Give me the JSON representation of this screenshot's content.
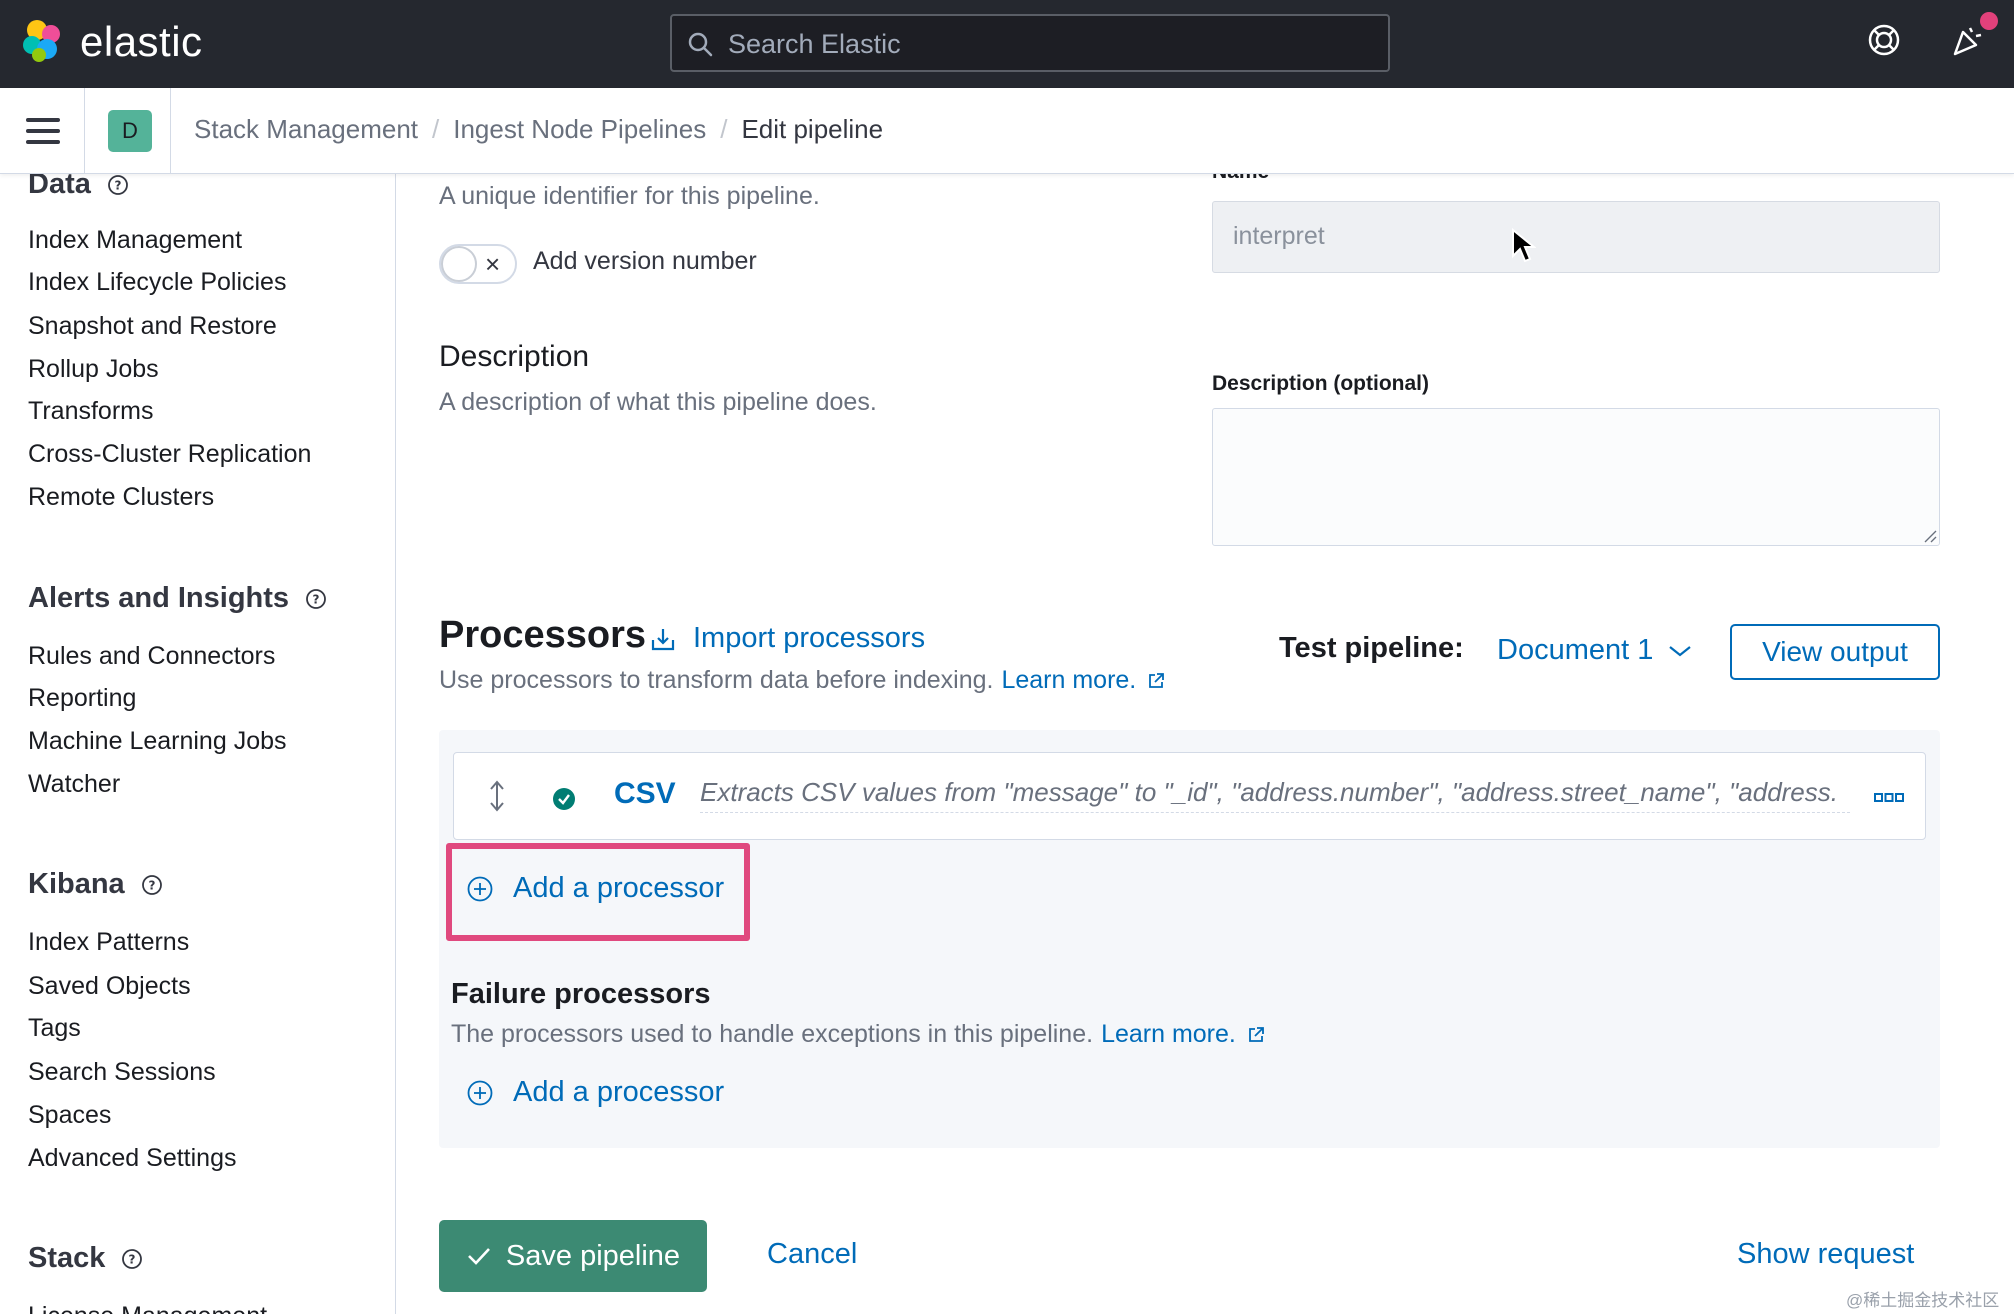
{
  "header": {
    "brand": "elastic",
    "search_placeholder": "Search Elastic",
    "accent": "#e2417b"
  },
  "breadcrumbs": {
    "space_initial": "D",
    "items": [
      "Stack Management",
      "Ingest Node Pipelines",
      "Edit pipeline"
    ]
  },
  "sidebar": {
    "sections": [
      {
        "title": "Data",
        "items": [
          "Index Management",
          "Index Lifecycle Policies",
          "Snapshot and Restore",
          "Rollup Jobs",
          "Transforms",
          "Cross-Cluster Replication",
          "Remote Clusters"
        ]
      },
      {
        "title": "Alerts and Insights",
        "items": [
          "Rules and Connectors",
          "Reporting",
          "Machine Learning Jobs",
          "Watcher"
        ]
      },
      {
        "title": "Kibana",
        "items": [
          "Index Patterns",
          "Saved Objects",
          "Tags",
          "Search Sessions",
          "Spaces",
          "Advanced Settings"
        ]
      },
      {
        "title": "Stack",
        "items": [
          "License Management"
        ]
      }
    ]
  },
  "form": {
    "name_help": "A unique identifier for this pipeline.",
    "name_label": "Name",
    "name_value": "interpret",
    "version_toggle_label": "Add version number",
    "description_title": "Description",
    "description_help": "A description of what this pipeline does.",
    "description_label": "Description (optional)",
    "description_value": ""
  },
  "processors": {
    "title": "Processors",
    "import_label": "Import processors",
    "help_text": "Use processors to transform data before indexing.",
    "learn_more": "Learn more.",
    "test_label": "Test pipeline:",
    "document_select": "Document 1",
    "view_output": "View output",
    "items": [
      {
        "type": "CSV",
        "description": "Extracts CSV values from \"message\" to \"_id\", \"address.number\", \"address.street_name\", \"address."
      }
    ],
    "add_label": "Add a processor",
    "failure_title": "Failure processors",
    "failure_help": "The processors used to handle exceptions in this pipeline.",
    "failure_learn_more": "Learn more.",
    "failure_add_label": "Add a processor"
  },
  "footer": {
    "save": "Save pipeline",
    "cancel": "Cancel",
    "show_request": "Show request"
  },
  "watermark": "@稀土掘金技术社区"
}
